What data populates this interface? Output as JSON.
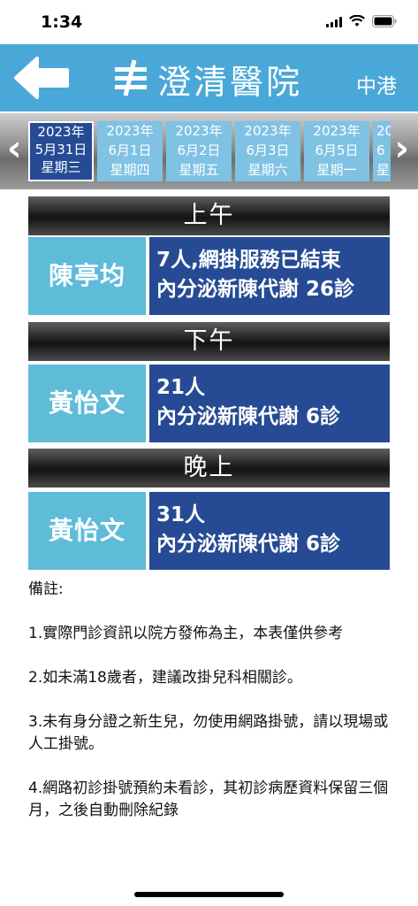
{
  "status_bar": {
    "time": "1:34"
  },
  "header": {
    "hospital_name": "澄清醫院",
    "branch_name": "中港"
  },
  "dates": [
    {
      "year": "2023年",
      "date": "5月31日",
      "weekday": "星期三",
      "selected": true
    },
    {
      "year": "2023年",
      "date": "6月1日",
      "weekday": "星期四",
      "selected": false
    },
    {
      "year": "2023年",
      "date": "6月2日",
      "weekday": "星期五",
      "selected": false
    },
    {
      "year": "2023年",
      "date": "6月3日",
      "weekday": "星期六",
      "selected": false
    },
    {
      "year": "2023年",
      "date": "6月5日",
      "weekday": "星期一",
      "selected": false
    },
    {
      "year": "20",
      "date": "6",
      "weekday": "星",
      "selected": false
    }
  ],
  "sessions": {
    "morning": {
      "label": "上午",
      "doctor": "陳亭均",
      "line1": "7人,網掛服務已結束",
      "line2": "內分泌新陳代謝 26診"
    },
    "afternoon": {
      "label": "下午",
      "doctor": "黃怡文",
      "line1": "21人",
      "line2": "內分泌新陳代謝 6診"
    },
    "evening": {
      "label": "晚上",
      "doctor": "黃怡文",
      "line1": "31人",
      "line2": "內分泌新陳代謝 6診"
    }
  },
  "notes": {
    "title": "備註:",
    "items": [
      "1.實際門診資訊以院方發佈為主，本表僅供參考",
      "2.如未滿18歲者，建議改掛兒科相關診。",
      "3.未有身分證之新生兒，勿使用網路掛號，請以現場或人工掛號。",
      "4.網路初診掛號預約未看診，其初診病歷資料保留三個月，之後自動刪除紀錄"
    ]
  },
  "colors": {
    "header_bg": "#4aa8d8",
    "selected_date": "#264b94",
    "date_bg": "#7fc2e4",
    "doctor_bg": "#5fbcd8",
    "info_bg": "#264b94"
  }
}
